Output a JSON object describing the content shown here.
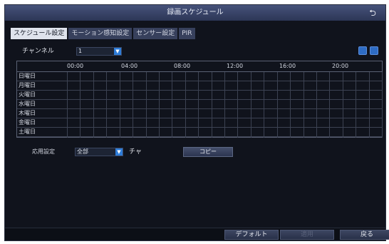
{
  "window": {
    "title": "録画スケジュール",
    "back_icon": "return-arrow-icon"
  },
  "tabs": [
    {
      "label": "スケジュール設定",
      "active": true
    },
    {
      "label": "モーション感知設定",
      "active": false
    },
    {
      "label": "センサー設定",
      "active": false
    },
    {
      "label": "PIR",
      "active": false
    }
  ],
  "channel": {
    "label": "チャンネル",
    "value": "1"
  },
  "toolbar_icons": [
    "settings-icon",
    "edit-icon"
  ],
  "schedule": {
    "time_labels": [
      "00:00",
      "04:00",
      "08:00",
      "12:00",
      "16:00",
      "20:00"
    ],
    "days": [
      "日曜日",
      "月曜日",
      "火曜日",
      "水曜日",
      "木曜日",
      "金曜日",
      "土曜日"
    ]
  },
  "apply": {
    "label": "応用設定",
    "value": "全部",
    "channel_suffix": "チャ",
    "copy_label": "コピー"
  },
  "footer": {
    "default_label": "デフォルト",
    "apply_label": "適用",
    "return_label": "戻る"
  },
  "colors": {
    "accent": "#2e7cd8",
    "title_bar": "#3a4568",
    "background": "#10131c"
  }
}
